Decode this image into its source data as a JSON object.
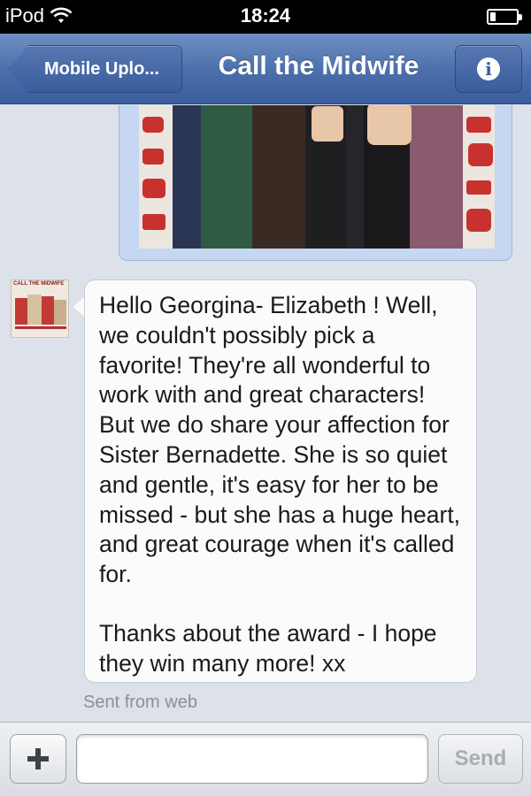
{
  "status_bar": {
    "carrier": "iPod",
    "time": "18:24",
    "battery_level": 0.2
  },
  "nav": {
    "back_label": "Mobile Uplo...",
    "title": "Call the Midwife",
    "info_icon": "info-icon"
  },
  "thread": {
    "photo_alt_icon": "photo-attachment",
    "avatar_text": "CALL THE MIDWIFE",
    "message_paragraphs": [
      "Hello Georgina- Elizabeth ! Well, we couldn't possibly pick a favorite! They're all wonderful to work with and great characters! But we do share your affection for Sister Bernadette. She is so quiet and gentle, it's easy for her to be missed - but she has a huge heart, and great courage when it's called for.",
      "Thanks about the award - I hope they win many more! xx"
    ],
    "sent_from": "Sent from web"
  },
  "composer": {
    "add_icon": "plus-icon",
    "input_value": "",
    "send_label": "Send"
  }
}
